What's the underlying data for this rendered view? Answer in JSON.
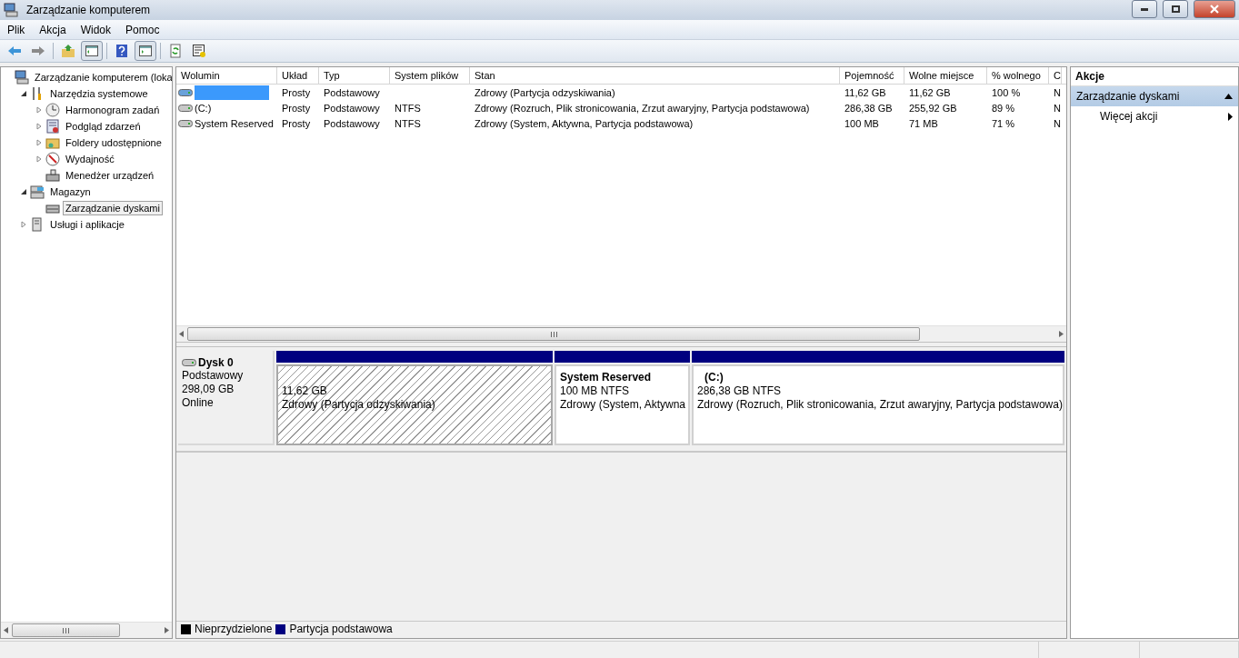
{
  "window": {
    "title": "Zarządzanie komputerem"
  },
  "menu": [
    "Plik",
    "Akcja",
    "Widok",
    "Pomoc"
  ],
  "toolbar": [
    {
      "kind": "back",
      "pressed": false
    },
    {
      "kind": "forward",
      "pressed": false
    },
    {
      "kind": "up",
      "pressed": false
    },
    {
      "kind": "tree",
      "pressed": true
    },
    {
      "kind": "help",
      "pressed": false
    },
    {
      "kind": "pane",
      "pressed": true
    },
    {
      "kind": "refresh",
      "pressed": false
    },
    {
      "kind": "export",
      "pressed": false
    }
  ],
  "tree": [
    {
      "label": "Zarządzanie komputerem (loka",
      "selected": false,
      "children": [
        {
          "label": "Narzędzia systemowe",
          "expanded": true,
          "selected": false,
          "children": [
            {
              "label": "Harmonogram zadań",
              "expanded": false,
              "selected": false
            },
            {
              "label": "Podgląd zdarzeń",
              "expanded": false,
              "selected": false
            },
            {
              "label": "Foldery udostępnione",
              "expanded": false,
              "selected": false
            },
            {
              "label": "Wydajność",
              "expanded": false,
              "selected": false
            },
            {
              "label": "Menedżer urządzeń",
              "selected": false
            }
          ]
        },
        {
          "label": "Magazyn",
          "expanded": true,
          "selected": false,
          "children": [
            {
              "label": "Zarządzanie dyskami",
              "selected": true
            }
          ]
        },
        {
          "label": "Usługi i aplikacje",
          "expanded": false,
          "selected": false
        }
      ]
    }
  ],
  "table": {
    "columns": [
      "Wolumin",
      "Układ",
      "Typ",
      "System plików",
      "Stan",
      "Pojemność",
      "Wolne miejsce",
      "% wolnego",
      "C"
    ],
    "rows": [
      {
        "cells": [
          null,
          "Prosty",
          "Podstawowy",
          null,
          "Zdrowy (Partycja odzyskiwania)",
          "11,62 GB",
          "11,62 GB",
          "100 %",
          "N"
        ]
      },
      {
        "cells": [
          "(C:)",
          "Prosty",
          "Podstawowy",
          "NTFS",
          "Zdrowy (Rozruch, Plik stronicowania, Zrzut awaryjny, Partycja podstawowa)",
          "286,38 GB",
          "255,92 GB",
          "89 %",
          "N"
        ]
      },
      {
        "cells": [
          "System Reserved",
          "Prosty",
          "Podstawowy",
          "NTFS",
          "Zdrowy (System, Aktywna, Partycja podstawowa)",
          "100 MB",
          "71 MB",
          "71 %",
          "N"
        ]
      }
    ]
  },
  "disk": {
    "name": "Dysk 0",
    "type": "Podstawowy",
    "size": "298,09 GB",
    "status": "Online",
    "partitions": [
      {
        "size": "11,62 GB",
        "status": "Zdrowy (Partycja odzyskiwania)",
        "selected": true,
        "color": "#000080"
      },
      {
        "title": "System Reserved",
        "size": "100 MB NTFS",
        "status": "Zdrowy (System, Aktywna",
        "selected": false,
        "color": "#000080"
      },
      {
        "title": "(C:)",
        "size": "286,38 GB NTFS",
        "status": "Zdrowy (Rozruch, Plik stronicowania, Zrzut awaryjny, Partycja podstawowa)",
        "selected": false,
        "color": "#000080"
      }
    ]
  },
  "legend": [
    {
      "label": "Nieprzydzielone",
      "color": "#000000"
    },
    {
      "label": "Partycja podstawowa",
      "color": "#000080"
    }
  ],
  "actions": {
    "title": "Akcje",
    "section": "Zarządzanie dyskami",
    "items": [
      "Więcej akcji"
    ]
  }
}
